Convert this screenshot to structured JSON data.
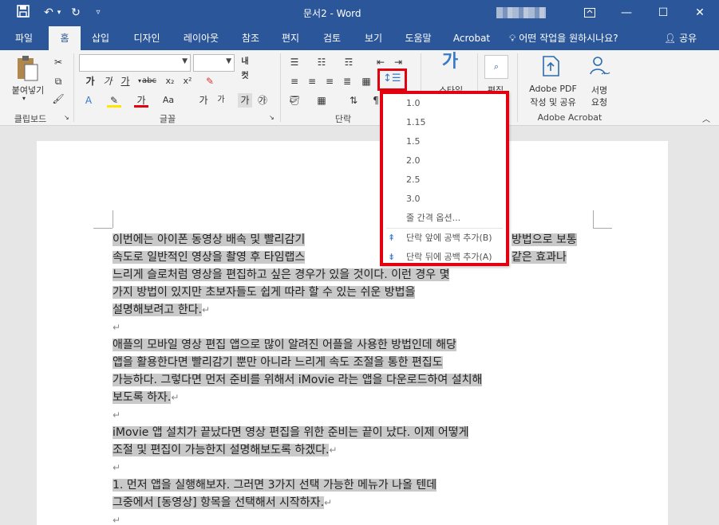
{
  "titlebar": {
    "qat": {
      "save": "save-icon",
      "undo": "undo-icon",
      "redo": "redo-icon",
      "customize": "chevron-down-icon"
    },
    "title": "문서2 - Word",
    "window_controls": [
      "ribbon-display-icon",
      "minimize-icon",
      "maximize-icon",
      "close-icon"
    ]
  },
  "tabs": [
    "파일",
    "홈",
    "삽입",
    "디자인",
    "레이아웃",
    "참조",
    "편지",
    "검토",
    "보기",
    "도움말",
    "Acrobat"
  ],
  "active_tab": "홈",
  "tell_me": "어떤 작업을 원하시나요?",
  "share": "공유",
  "ribbon": {
    "clipboard": {
      "paste": "붙여넣기",
      "label": "클립보드"
    },
    "font": {
      "name_value": "",
      "size_value": "",
      "buttons": [
        "가",
        "가",
        "가",
        "abc",
        "x₂",
        "x²"
      ],
      "grow": "가",
      "shrink": "가",
      "case": "Aa",
      "label": "글꼴"
    },
    "paragraph": {
      "label": "단락"
    },
    "styles": {
      "label": "스타일"
    },
    "editing": {
      "label": "편집"
    },
    "acrobat": {
      "create_pdf": [
        "Adobe PDF",
        "작성 및 공유"
      ],
      "signature": [
        "서명",
        "요청"
      ],
      "label": "Adobe Acrobat"
    }
  },
  "line_spacing_menu": {
    "values": [
      "1.0",
      "1.15",
      "1.5",
      "2.0",
      "2.5",
      "3.0"
    ],
    "options": "줄 간격 옵션...",
    "add_before": "단락 앞에 공백 추가(B)",
    "add_after": "단락 뒤에 공백 추가(A)"
  },
  "document": {
    "p1": [
      "이번에는 아이폰 동영상 배속 및 빨리감기",
      "속도로 일반적인 영상을 촬영 후 타임랩스",
      "느리게 슬로처럼 영상을 편집하고 싶은 경우가 있을 것이다. 이런 경우 몇",
      "가지 방법이 있지만 초보자들도 쉽게 따라 할 수 있는 쉬운 방법을",
      "설명해보려고 한다."
    ],
    "p1_right": [
      "방법으로 보통",
      "같은 효과나"
    ],
    "p2": [
      "애플의 모바일 영상 편집 앱으로 많이 알려진 어플을 사용한 방법인데 해당",
      "앱을 활용한다면 빨리감기 뿐만 아니라 느리게 속도 조절을 통한 편집도",
      "가능하다. 그렇다면 먼저 준비를 위해서 iMovie 라는 앱을 다운로드하여 설치해",
      "보도록 하자."
    ],
    "p3": [
      "iMovie 앱 설치가 끝났다면 영상 편집을 위한 준비는 끝이 났다. 이제 어떻게",
      "조절 및 편집이 가능한지 설명해보도록 하겠다."
    ],
    "p4": [
      "1. 먼저 앱을 실행해보자. 그러면 3가지 선택 가능한 메뉴가 나올 텐데",
      "그중에서 [동영상] 항목을 선택해서 시작하자."
    ],
    "paragraph_mark": "↵"
  }
}
